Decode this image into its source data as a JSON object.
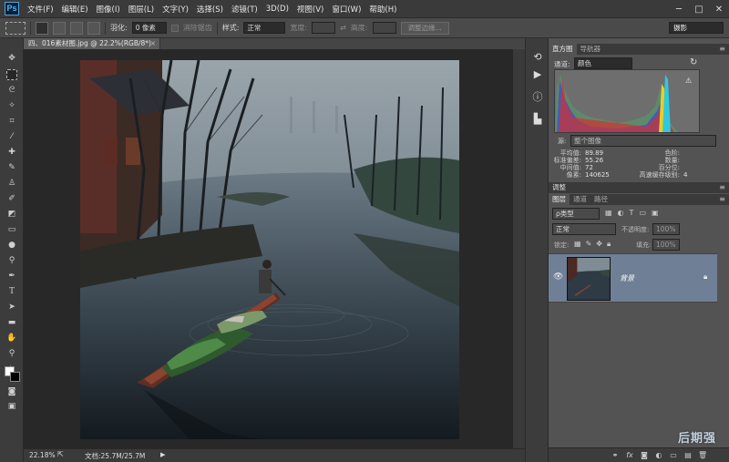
{
  "app": {
    "logo": "Ps"
  },
  "menu": [
    "文件(F)",
    "编辑(E)",
    "图像(I)",
    "图层(L)",
    "文字(Y)",
    "选择(S)",
    "滤镜(T)",
    "3D(D)",
    "视图(V)",
    "窗口(W)",
    "帮助(H)"
  ],
  "window_controls": {
    "minimize": "─",
    "maximize": "□",
    "close": "✕"
  },
  "options": {
    "feather_label": "羽化:",
    "feather_value": "0 像素",
    "antialias_label": "消除锯齿",
    "style_label": "样式:",
    "style_value": "正常",
    "width_label": "宽度:",
    "height_label": "高度:",
    "refine_edge": "调整边缘...",
    "workspace": "摄影"
  },
  "document": {
    "tab_title": "四、016素材图.jpg @ 22.2%(RGB/8*)",
    "tab_close": "×"
  },
  "status": {
    "zoom": "22.18%",
    "doc_info": "文档:25.7M/25.7M"
  },
  "histogram_panel": {
    "tabs": [
      "直方图",
      "导航器"
    ],
    "channel_label": "通道:",
    "channel_value": "颜色",
    "source_label": "源:",
    "source_value": "整个图像",
    "stats_left": [
      {
        "label": "平均值:",
        "value": "89.89"
      },
      {
        "label": "标准偏差:",
        "value": "55.26"
      },
      {
        "label": "中间值:",
        "value": "72"
      },
      {
        "label": "像素:",
        "value": "140625"
      }
    ],
    "stats_right": [
      {
        "label": "色阶:",
        "value": ""
      },
      {
        "label": "数量:",
        "value": ""
      },
      {
        "label": "百分位:",
        "value": ""
      },
      {
        "label": "高速缓存级别:",
        "value": "4"
      }
    ]
  },
  "adjust_panel": {
    "tab": "调整"
  },
  "layers_panel": {
    "tabs": [
      "图层",
      "通道",
      "路径"
    ],
    "kind_label": "ρ类型",
    "blend_mode": "正常",
    "opacity_label": "不透明度:",
    "opacity_value": "100%",
    "lock_label": "锁定:",
    "fill_label": "填充:",
    "fill_value": "100%",
    "layer_name": "背景"
  },
  "watermark": "后期强"
}
